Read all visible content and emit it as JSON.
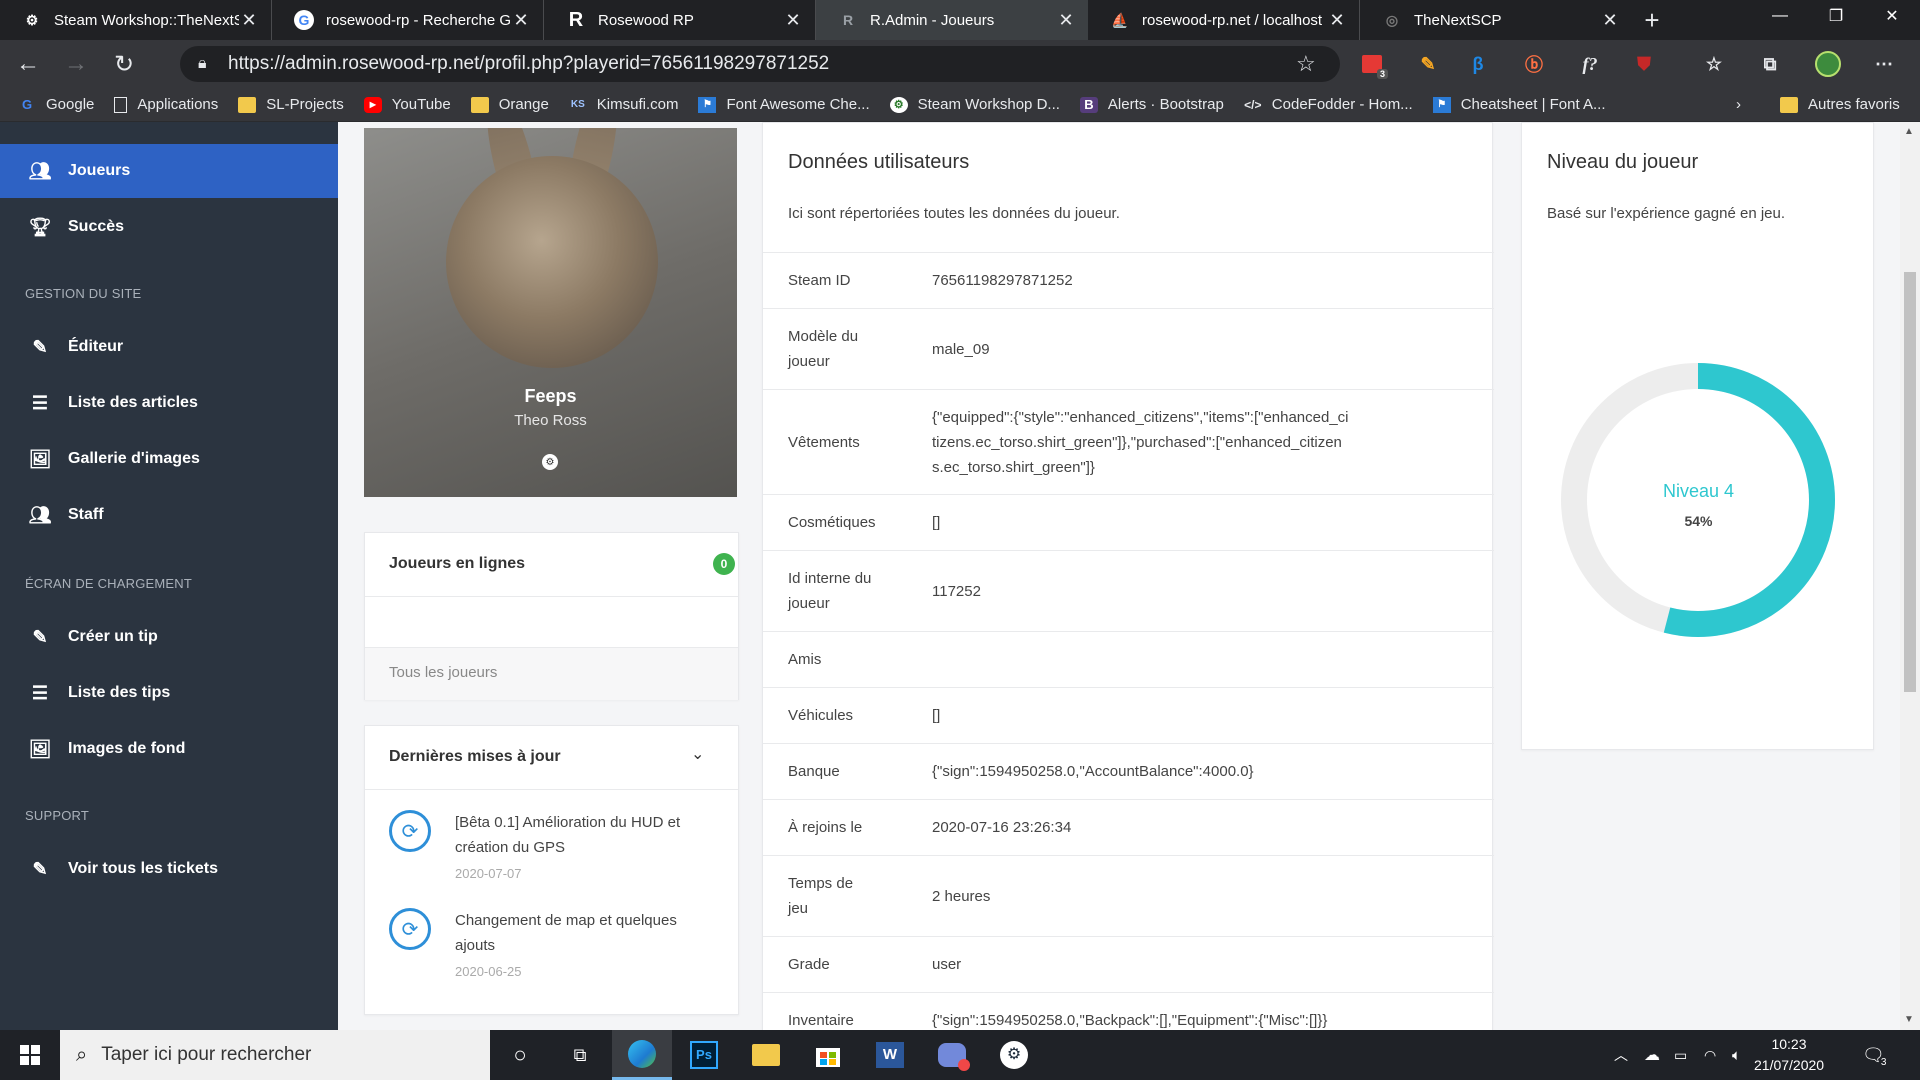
{
  "browser": {
    "tabs": [
      {
        "title": "Steam Workshop::TheNextSCP",
        "icon": "steam-icon"
      },
      {
        "title": "rosewood-rp - Recherche Google",
        "icon": "google-icon"
      },
      {
        "title": "Rosewood RP",
        "icon": "rosewood-icon"
      },
      {
        "title": "R.Admin - Joueurs",
        "icon": "radmin-icon"
      },
      {
        "title": "rosewood-rp.net / localhost",
        "icon": "phpmyadmin-icon"
      },
      {
        "title": "TheNextSCP",
        "icon": "scp-icon"
      }
    ],
    "active_tab": 3,
    "url": "https://admin.rosewood-rp.net/profil.php?playerid=76561198297871252",
    "extension_badge": "3",
    "bookmarks": [
      {
        "label": "Google",
        "icon": "google-icon"
      },
      {
        "label": "Applications",
        "icon": "page-icon"
      },
      {
        "label": "SL-Projects",
        "icon": "folder-icon"
      },
      {
        "label": "YouTube",
        "icon": "youtube-icon"
      },
      {
        "label": "Orange",
        "icon": "folder-icon"
      },
      {
        "label": "Kimsufi.com",
        "icon": "kimsufi-icon"
      },
      {
        "label": "Font Awesome Che...",
        "icon": "flag-icon"
      },
      {
        "label": "Steam Workshop D...",
        "icon": "steam-icon"
      },
      {
        "label": "Alerts · Bootstrap",
        "icon": "bootstrap-icon"
      },
      {
        "label": "CodeFodder - Hom...",
        "icon": "code-icon"
      },
      {
        "label": "Cheatsheet | Font A...",
        "icon": "flag-icon"
      }
    ],
    "other_bookmarks": "Autres favoris"
  },
  "sidebar": {
    "items_top": [
      {
        "label": "Joueurs",
        "icon": "users-icon",
        "active": true
      },
      {
        "label": "Succès",
        "icon": "trophy-icon"
      }
    ],
    "section_site": "GESTION DU SITE",
    "items_site": [
      {
        "label": "Éditeur",
        "icon": "pencil-icon"
      },
      {
        "label": "Liste des articles",
        "icon": "list-icon"
      },
      {
        "label": "Gallerie d'images",
        "icon": "images-icon"
      },
      {
        "label": "Staff",
        "icon": "users-icon"
      }
    ],
    "section_loading": "ÉCRAN DE CHARGEMENT",
    "items_loading": [
      {
        "label": "Créer un tip",
        "icon": "pencil-icon"
      },
      {
        "label": "Liste des tips",
        "icon": "list-icon"
      },
      {
        "label": "Images de fond",
        "icon": "images-icon"
      }
    ],
    "section_support": "SUPPORT",
    "items_support": [
      {
        "label": "Voir tous les tickets",
        "icon": "pencil-icon"
      }
    ]
  },
  "profile": {
    "name": "Feeps",
    "subtitle": "Theo Ross"
  },
  "online": {
    "title": "Joueurs en lignes",
    "count": "0",
    "all_link": "Tous les joueurs"
  },
  "updates": {
    "title": "Dernières mises à jour",
    "items": [
      {
        "title": "[Bêta 0.1] Amélioration du HUD et création du GPS",
        "date": "2020-07-07"
      },
      {
        "title": "Changement de map et quelques ajouts",
        "date": "2020-06-25"
      }
    ]
  },
  "user_data": {
    "title": "Données utilisateurs",
    "description": "Ici sont répertoriées toutes les données du joueur.",
    "rows": [
      {
        "key": "Steam ID",
        "value": "76561198297871252"
      },
      {
        "key": "Modèle du joueur",
        "value": "male_09"
      },
      {
        "key": "Vêtements",
        "value": "{\"equipped\":{\"style\":\"enhanced_citizens\",\"items\":[\"enhanced_citizens.ec_torso.shirt_green\"]},\"purchased\":[\"enhanced_citizens.ec_torso.shirt_green\"]}"
      },
      {
        "key": "Cosmétiques",
        "value": "[]"
      },
      {
        "key": "Id interne du joueur",
        "value": "117252"
      },
      {
        "key": "Amis",
        "value": ""
      },
      {
        "key": "Véhicules",
        "value": "[]"
      },
      {
        "key": "Banque",
        "value": "{\"sign\":1594950258.0,\"AccountBalance\":4000.0}"
      },
      {
        "key": "À rejoins le",
        "value": "2020-07-16 23:26:34"
      },
      {
        "key": "Temps de jeu",
        "value": "2 heures"
      },
      {
        "key": "Grade",
        "value": "user"
      },
      {
        "key": "Inventaire",
        "value": "{\"sign\":1594950258.0,\"Backpack\":[],\"Equipment\":{\"Misc\":[]}}"
      }
    ]
  },
  "level": {
    "title": "Niveau du joueur",
    "description": "Basé sur l'expérience gagné en jeu.",
    "label": "Niveau 4",
    "percent_text": "54%",
    "progress": 0.54,
    "accent": "#2ec7cf"
  },
  "taskbar": {
    "search_placeholder": "Taper ici pour rechercher",
    "time": "10:23",
    "date": "21/07/2020",
    "notifications": "3"
  },
  "colors": {
    "sidebar_bg": "#2b3440",
    "sidebar_active": "#2e62c4",
    "online_badge": "#3fb34f"
  }
}
